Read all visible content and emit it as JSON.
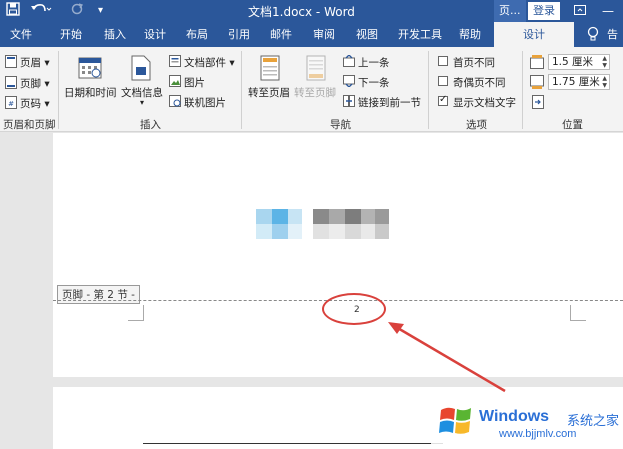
{
  "titlebar": {
    "save_icon": "save-icon",
    "undo_icon": "undo-icon",
    "redo_icon": "redo-icon",
    "title": "文档1.docx  -  Word",
    "context_label": "页...",
    "login": "登录",
    "restore_icon": "restore-icon",
    "minimize_icon": "minimize-icon"
  },
  "tabs": [
    {
      "label": "文件"
    },
    {
      "label": "开始"
    },
    {
      "label": "插入"
    },
    {
      "label": "设计"
    },
    {
      "label": "布局"
    },
    {
      "label": "引用"
    },
    {
      "label": "邮件"
    },
    {
      "label": "审阅"
    },
    {
      "label": "视图"
    },
    {
      "label": "开发工具"
    },
    {
      "label": "帮助"
    },
    {
      "label": "设计"
    }
  ],
  "tell_me": "告",
  "ribbon": {
    "header_footer": {
      "header": "页眉",
      "footer": "页脚",
      "page_number": "页码",
      "group": "页眉和页脚"
    },
    "insert": {
      "date_time": "日期和时间",
      "doc_info": "文档信息",
      "quick_parts": "文档部件",
      "picture": "图片",
      "online_picture": "联机图片",
      "group": "插入"
    },
    "navigation": {
      "goto_header": "转至页眉",
      "goto_footer": "转至页脚",
      "previous": "上一条",
      "next": "下一条",
      "link_previous": "链接到前一节",
      "group": "导航"
    },
    "options": {
      "different_first": "首页不同",
      "different_odd_even": "奇偶页不同",
      "show_doc_text": "显示文档文字",
      "group": "选项"
    },
    "position": {
      "header_from_top": "1.5 厘米",
      "footer_from_bottom": "1.75 厘米",
      "group": "位置"
    }
  },
  "document": {
    "footer_tag": "页脚 - 第 2 节 -",
    "page_number": "2"
  },
  "watermark": {
    "brand": "Windows",
    "brand_cn": "系统之家",
    "url": "www.bjjmlv.com"
  },
  "colors": {
    "word_blue": "#2b579a",
    "annotation_red": "#d9413c",
    "watermark_blue": "#2a6fd6"
  }
}
